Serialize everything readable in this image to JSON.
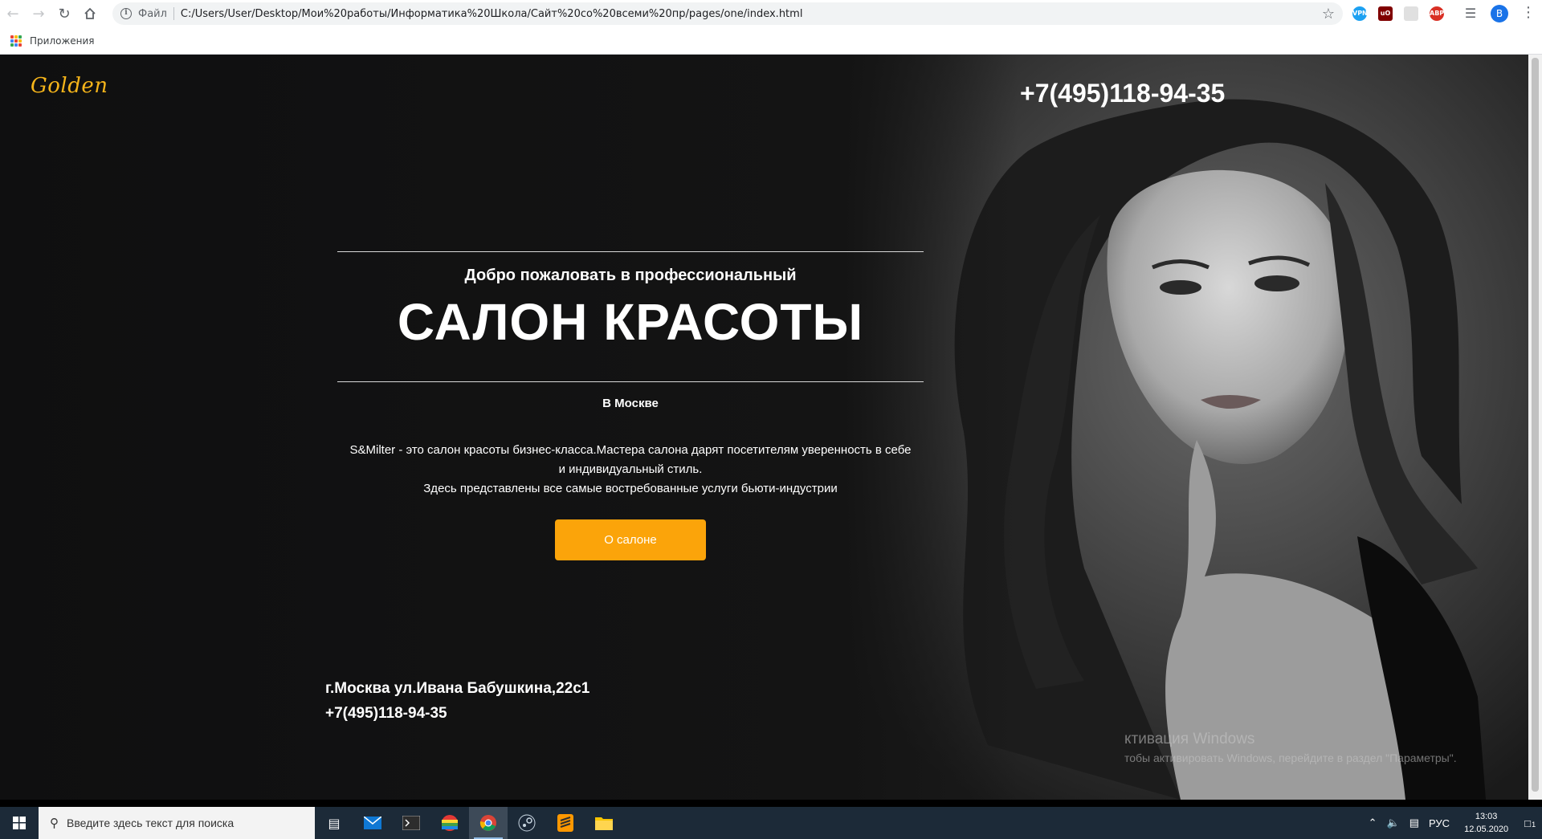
{
  "browser": {
    "address_scheme": "Файл",
    "url": "C:/Users/User/Desktop/Мои%20работы/Информатика%20Школа/Сайт%20со%20всеми%20пр/pages/one/index.html",
    "bookmarks_label": "Приложения",
    "profile_initial": "В",
    "extensions": [
      "VPN",
      "uO",
      "ABP"
    ]
  },
  "site": {
    "logo": "Golden",
    "phone_top": "+7(495)118-94-35",
    "hero": {
      "welcome": "Добро пожаловать в профессиональный",
      "title": "САЛОН КРАСОТЫ",
      "city": "В Москве",
      "description_line1": "S&Milter - это салон красоты бизнес-класса.Мастера салона дарят посетителям уверенность в себе",
      "description_line2": "и индивидуальный стиль.",
      "description_line3": "Здесь представлены все самые востребованные услуги бьюти-индустрии",
      "cta_label": "О салоне"
    },
    "footer": {
      "address": "г.Москва ул.Ивана Бабушкина,22с1",
      "phone": "+7(495)118-94-35"
    }
  },
  "watermark": {
    "line1": "ктивация Windows",
    "line2": "тобы активировать Windows, перейдите в раздел \"Параметры\"."
  },
  "taskbar": {
    "search_placeholder": "Введите здесь текст для поиска",
    "language": "РУС",
    "time": "13:03",
    "date": "12.05.2020",
    "notification_count": "1"
  },
  "colors": {
    "accent": "#fba40a",
    "logo": "#f5b41a",
    "taskbar": "#1c2a38"
  }
}
